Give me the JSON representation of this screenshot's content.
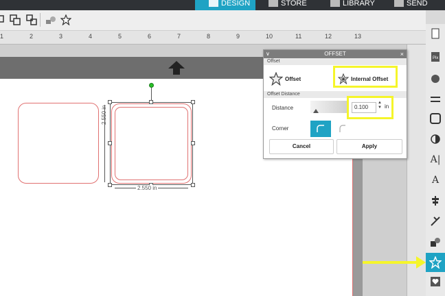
{
  "top_tabs": [
    {
      "label": "DESIGN",
      "active": true
    },
    {
      "label": "STORE"
    },
    {
      "label": "LIBRARY"
    },
    {
      "label": "SEND"
    }
  ],
  "ruler": {
    "top_numbers": [
      "1",
      "2",
      "3",
      "4",
      "5",
      "6",
      "7",
      "8",
      "9",
      "10",
      "11",
      "12",
      "13"
    ]
  },
  "shapes": {
    "width_label": "2.550 in",
    "height_label": "2.550 in"
  },
  "offset_panel": {
    "title": "OFFSET",
    "section_offset": "Offset",
    "option_offset": "Offset",
    "option_internal": "Internal Offset",
    "section_distance": "Offset Distance",
    "distance_label": "Distance",
    "distance_value": "0.100",
    "distance_unit": "in",
    "corner_label": "Corner",
    "cancel": "Cancel",
    "apply": "Apply"
  },
  "colors": {
    "accent": "#1fa3c4",
    "highlight": "#f5f52a",
    "shape_outline": "#e07070"
  }
}
